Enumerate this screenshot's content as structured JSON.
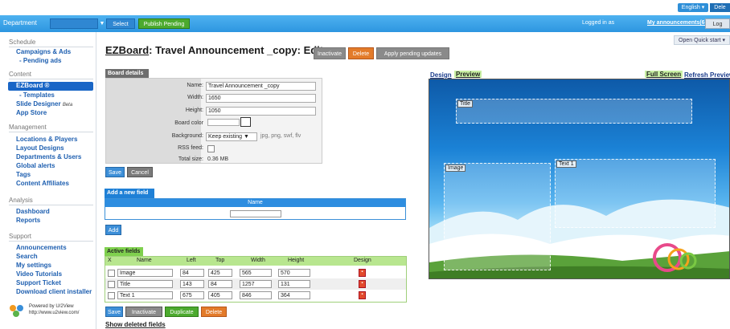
{
  "colors": {
    "header": "#3aa3e8",
    "accent_green": "#4caa2e",
    "sidebar_link": "#1e5fb0",
    "danger": "#e37b2a"
  },
  "topbar": {
    "language": "English",
    "logout_label": "Dele"
  },
  "header": {
    "department_label": "Department",
    "select_button": "Select",
    "publish_button": "Publish Pending",
    "logged_in_label": "Logged in as",
    "my_announcements": "My announcements(6)",
    "log_button": "Log",
    "quick_start": "Open Quick start"
  },
  "sidebar": {
    "sections": [
      {
        "title": "Schedule",
        "items": [
          {
            "label": "Campaigns & Ads"
          },
          {
            "label": "- Pending ads"
          }
        ]
      },
      {
        "title": "Content",
        "items": [
          {
            "label": "EZBoard ®"
          },
          {
            "label": "- Templates"
          },
          {
            "label": "Slide Designer",
            "badge": "Beta"
          },
          {
            "label": "App Store"
          }
        ]
      },
      {
        "title": "Management",
        "items": [
          {
            "label": "Locations & Players"
          },
          {
            "label": "Layout Designs"
          },
          {
            "label": "Departments & Users"
          },
          {
            "label": "Global alerts"
          },
          {
            "label": "Tags"
          },
          {
            "label": "Content Affiliates"
          }
        ]
      },
      {
        "title": "Analysis",
        "items": [
          {
            "label": "Dashboard"
          },
          {
            "label": "Reports"
          }
        ]
      },
      {
        "title": "Support",
        "items": [
          {
            "label": "Announcements"
          },
          {
            "label": "Search"
          },
          {
            "label": "My settings"
          },
          {
            "label": "Video Tutorials"
          },
          {
            "label": "Support Ticket"
          },
          {
            "label": "Download client installer"
          }
        ]
      }
    ],
    "powered_by": "Powered by U/2View",
    "powered_url": "http://www.u2view.com/"
  },
  "page": {
    "title_prefix": "EZBoard",
    "title_suffix": ": Travel Announcement _copy: Edit...",
    "buttons": {
      "inactivate": "Inactivate",
      "delete": "Delete",
      "apply": "Apply pending updates"
    }
  },
  "board_details": {
    "tab": "Board details",
    "labels": {
      "name": "Name:",
      "width": "Width:",
      "height": "Height:",
      "board_color": "Board color",
      "background": "Background:",
      "rss_feed": "RSS feed:",
      "total_size": "Total size:"
    },
    "name": "Travel Announcement _copy",
    "width": "1650",
    "height": "1050",
    "background_option": "Keep existing",
    "background_hint": "jpg, png, swf, flv",
    "total_size": "0.36 MB",
    "save": "Save",
    "cancel": "Cancel"
  },
  "add_field": {
    "tab": "Add a new field",
    "name_header": "Name",
    "add_button": "Add"
  },
  "active_fields": {
    "tab": "Active fields",
    "headers": {
      "x": "X",
      "name": "Name",
      "left": "Left",
      "top": "Top",
      "width": "Width",
      "height": "Height",
      "design": "Design"
    },
    "rows": [
      {
        "name": "Image",
        "left": "84",
        "top": "425",
        "width": "565",
        "height": "570"
      },
      {
        "name": "Title",
        "left": "143",
        "top": "84",
        "width": "1257",
        "height": "131"
      },
      {
        "name": "Text 1",
        "left": "675",
        "top": "405",
        "width": "846",
        "height": "364"
      }
    ],
    "buttons": {
      "save": "Save",
      "inactivate": "Inactivate",
      "duplicate": "Duplicate",
      "delete": "Delete"
    },
    "show_deleted": "Show deleted fields"
  },
  "preview": {
    "tab_design": "Design",
    "tab_preview": "Preview",
    "full_screen": "Full Screen",
    "refresh": "Refresh Preview",
    "zones": [
      {
        "label": "Title"
      },
      {
        "label": "Image"
      },
      {
        "label": "Text 1"
      }
    ]
  }
}
